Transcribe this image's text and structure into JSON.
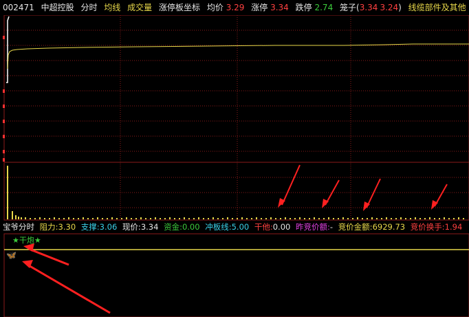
{
  "header": {
    "code": "002471",
    "name": "中超控股",
    "tab_time": "分时",
    "tab_avg": "均线",
    "tab_volume": "成交量",
    "tab_limit": "涨停板坐标",
    "avg_label": "均价",
    "avg_value": "3.29",
    "limit_up_label": "涨停",
    "limit_up_value": "3.34",
    "limit_down_label": "跌停",
    "limit_down_value": "2.74",
    "candle_label": "笼子(",
    "candle_v1": "3.34",
    "candle_v2": "3.24",
    "candle_close": ")",
    "more": "线缆部件及其他"
  },
  "indicator_bar": {
    "name": "宝爷分时",
    "resist_label": "阻力:",
    "resist_value": "3.30",
    "support_label": "支撑:",
    "support_value": "3.06",
    "price_label": "现价:",
    "price_value": "3.34",
    "fund_label": "资金:",
    "fund_value": "0.00",
    "board_label": "冲板线:",
    "board_value": "5.00",
    "gan_label": "干他:",
    "gan_value": "0.00",
    "prev_bid_label": "昨竞价额:",
    "prev_bid_value": "-",
    "bid_amount_label": "竞价金额:",
    "bid_amount_value": "6929.73",
    "bid_turnover_label": "竞价换手:",
    "bid_turnover_value": "1.94"
  },
  "signal_label": "★干炮★",
  "butterfly_glyph": "🦋",
  "colors": {
    "background": "#000000",
    "grid": "#8b1a1a",
    "price_line": "#e8d84a",
    "arrow": "#ff2020"
  }
}
